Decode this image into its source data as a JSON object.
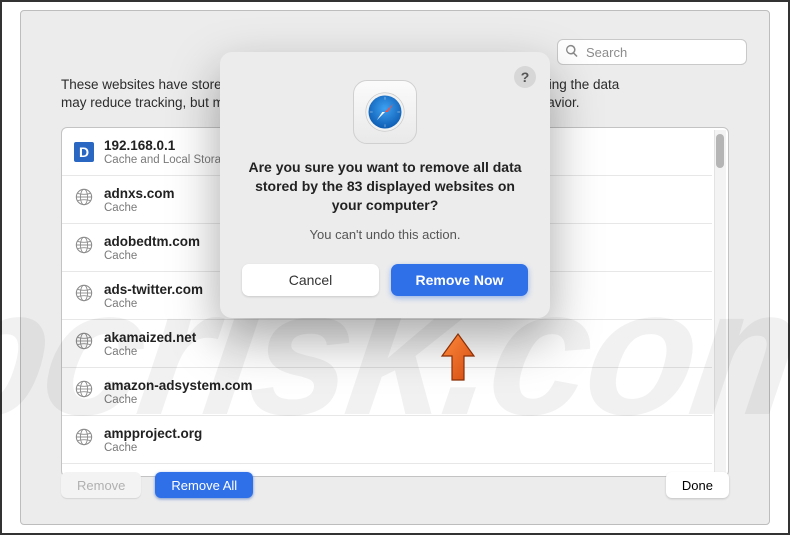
{
  "search": {
    "placeholder": "Search"
  },
  "desc_line1": "These websites have stored data that can be used to track your browsing. Removing the data",
  "desc_line2": "may reduce tracking, but may also log you out of websites or change website behavior.",
  "websites": [
    {
      "domain": "192.168.0.1",
      "sub": "Cache and Local Storage",
      "icon": "D"
    },
    {
      "domain": "adnxs.com",
      "sub": "Cache",
      "icon": "globe"
    },
    {
      "domain": "adobedtm.com",
      "sub": "Cache",
      "icon": "globe"
    },
    {
      "domain": "ads-twitter.com",
      "sub": "Cache",
      "icon": "globe"
    },
    {
      "domain": "akamaized.net",
      "sub": "Cache",
      "icon": "globe"
    },
    {
      "domain": "amazon-adsystem.com",
      "sub": "Cache",
      "icon": "globe"
    },
    {
      "domain": "ampproject.org",
      "sub": "Cache",
      "icon": "globe"
    }
  ],
  "footer": {
    "remove": "Remove",
    "remove_all": "Remove All",
    "done": "Done"
  },
  "dialog": {
    "title": "Are you sure you want to remove all data stored by the 83 displayed websites on your computer?",
    "subtitle": "You can't undo this action.",
    "cancel": "Cancel",
    "remove_now": "Remove Now",
    "help": "?"
  },
  "watermark": "pcrisk.com"
}
